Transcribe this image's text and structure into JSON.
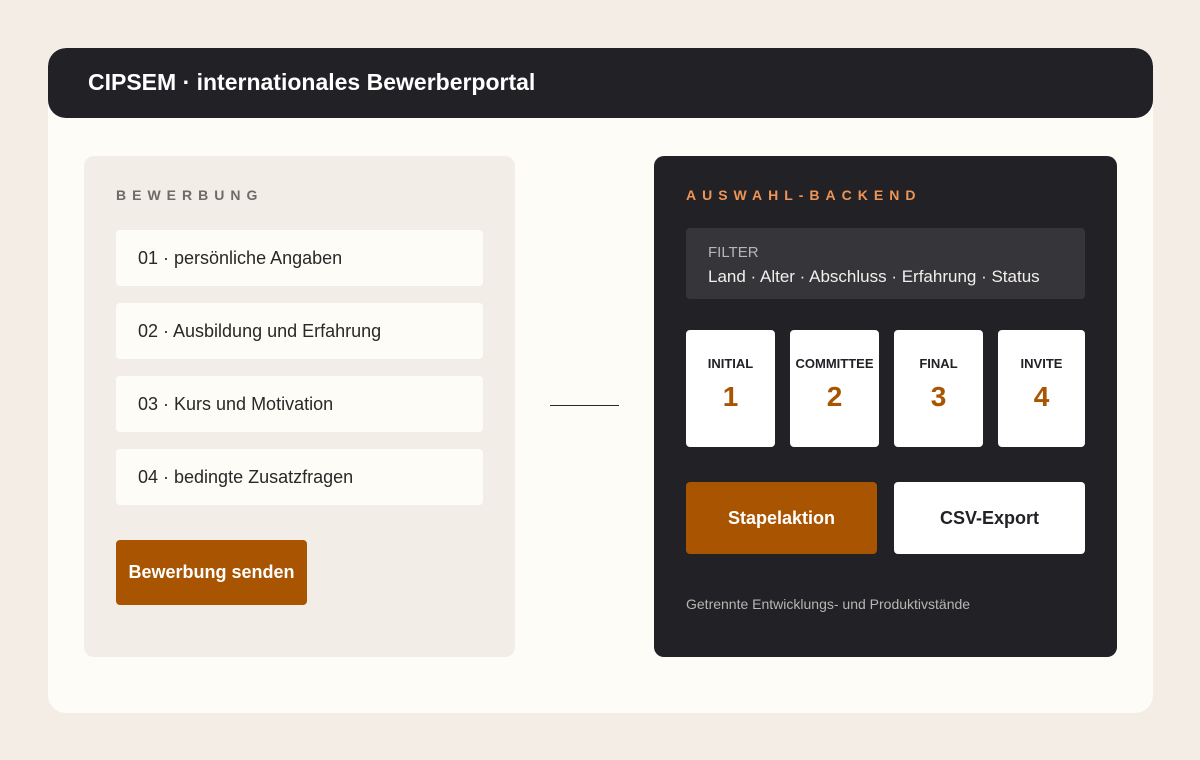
{
  "header": {
    "title": "CIPSEM · internationales Bewerberportal"
  },
  "application": {
    "section_label": "BEWERBUNG",
    "steps": [
      {
        "label": "01 · persönliche Angaben"
      },
      {
        "label": "02 · Ausbildung und Erfahrung"
      },
      {
        "label": "03 · Kurs und Motivation"
      },
      {
        "label": "04 · bedingte Zusatzfragen"
      }
    ],
    "submit_label": "Bewerbung senden"
  },
  "backend": {
    "section_label": "AUSWAHL-BACKEND",
    "filter": {
      "title": "FILTER",
      "values": "Land · Alter · Abschluss · Erfahrung · Status"
    },
    "stages": [
      {
        "name": "INITIAL",
        "number": "1"
      },
      {
        "name": "COMMITTEE",
        "number": "2"
      },
      {
        "name": "FINAL",
        "number": "3"
      },
      {
        "name": "INVITE",
        "number": "4"
      }
    ],
    "batch_label": "Stapelaktion",
    "csv_label": "CSV-Export",
    "footnote": "Getrennte Entwicklungs- und Produktivstände"
  },
  "colors": {
    "accent": "#a85400",
    "accent_light": "#ef9454",
    "dark": "#212126",
    "background": "#f3ede6"
  }
}
